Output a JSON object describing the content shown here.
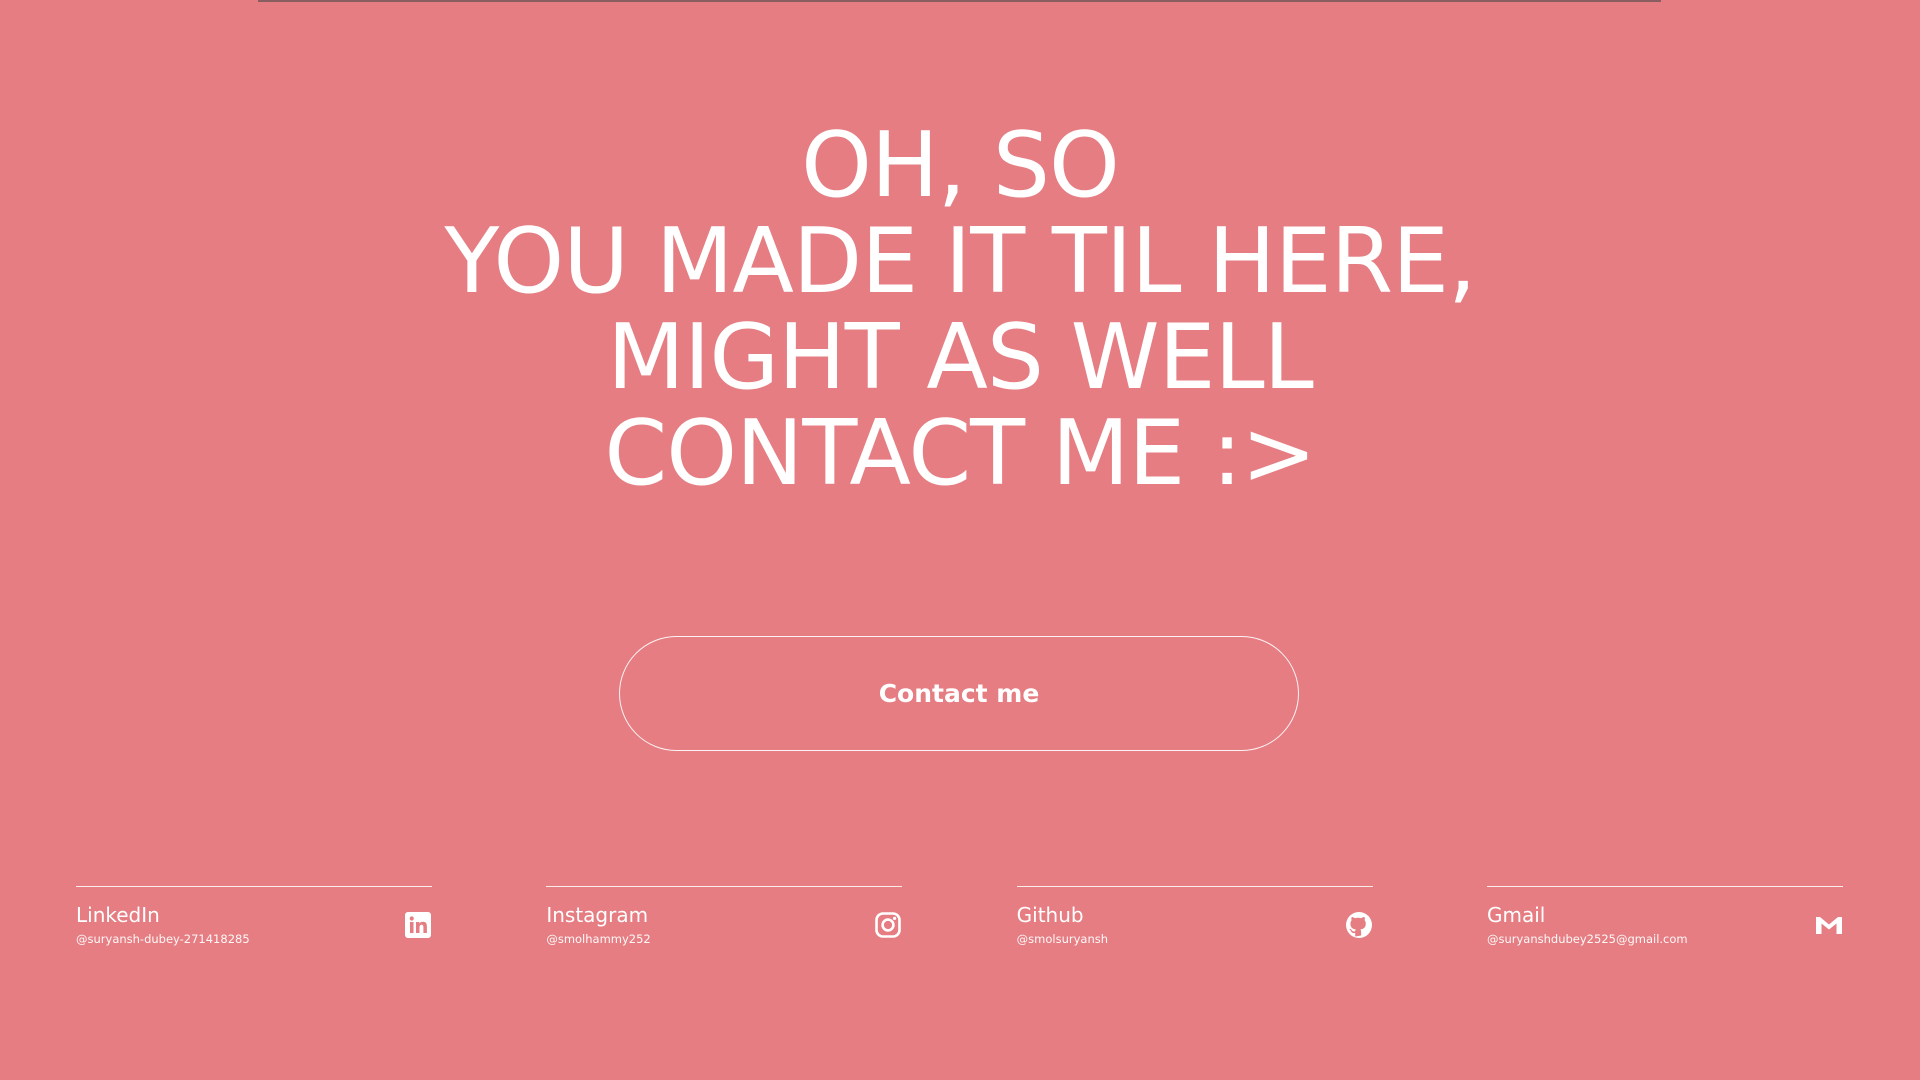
{
  "colors": {
    "background": "#e57d82",
    "text": "#ffffff"
  },
  "hero": {
    "lines": [
      "OH, SO",
      "YOU MADE IT TIL HERE,",
      "MIGHT AS WELL",
      "CONTACT ME :>"
    ]
  },
  "contact_button": {
    "label": "Contact me"
  },
  "socials": [
    {
      "name": "LinkedIn",
      "handle": "@suryansh-dubey-271418285",
      "icon": "linkedin-icon"
    },
    {
      "name": "Instagram",
      "handle": "@smolhammy252",
      "icon": "instagram-icon"
    },
    {
      "name": "Github",
      "handle": "@smolsuryansh",
      "icon": "github-icon"
    },
    {
      "name": "Gmail",
      "handle": "@suryanshdubey2525@gmail.com",
      "icon": "gmail-icon"
    }
  ]
}
